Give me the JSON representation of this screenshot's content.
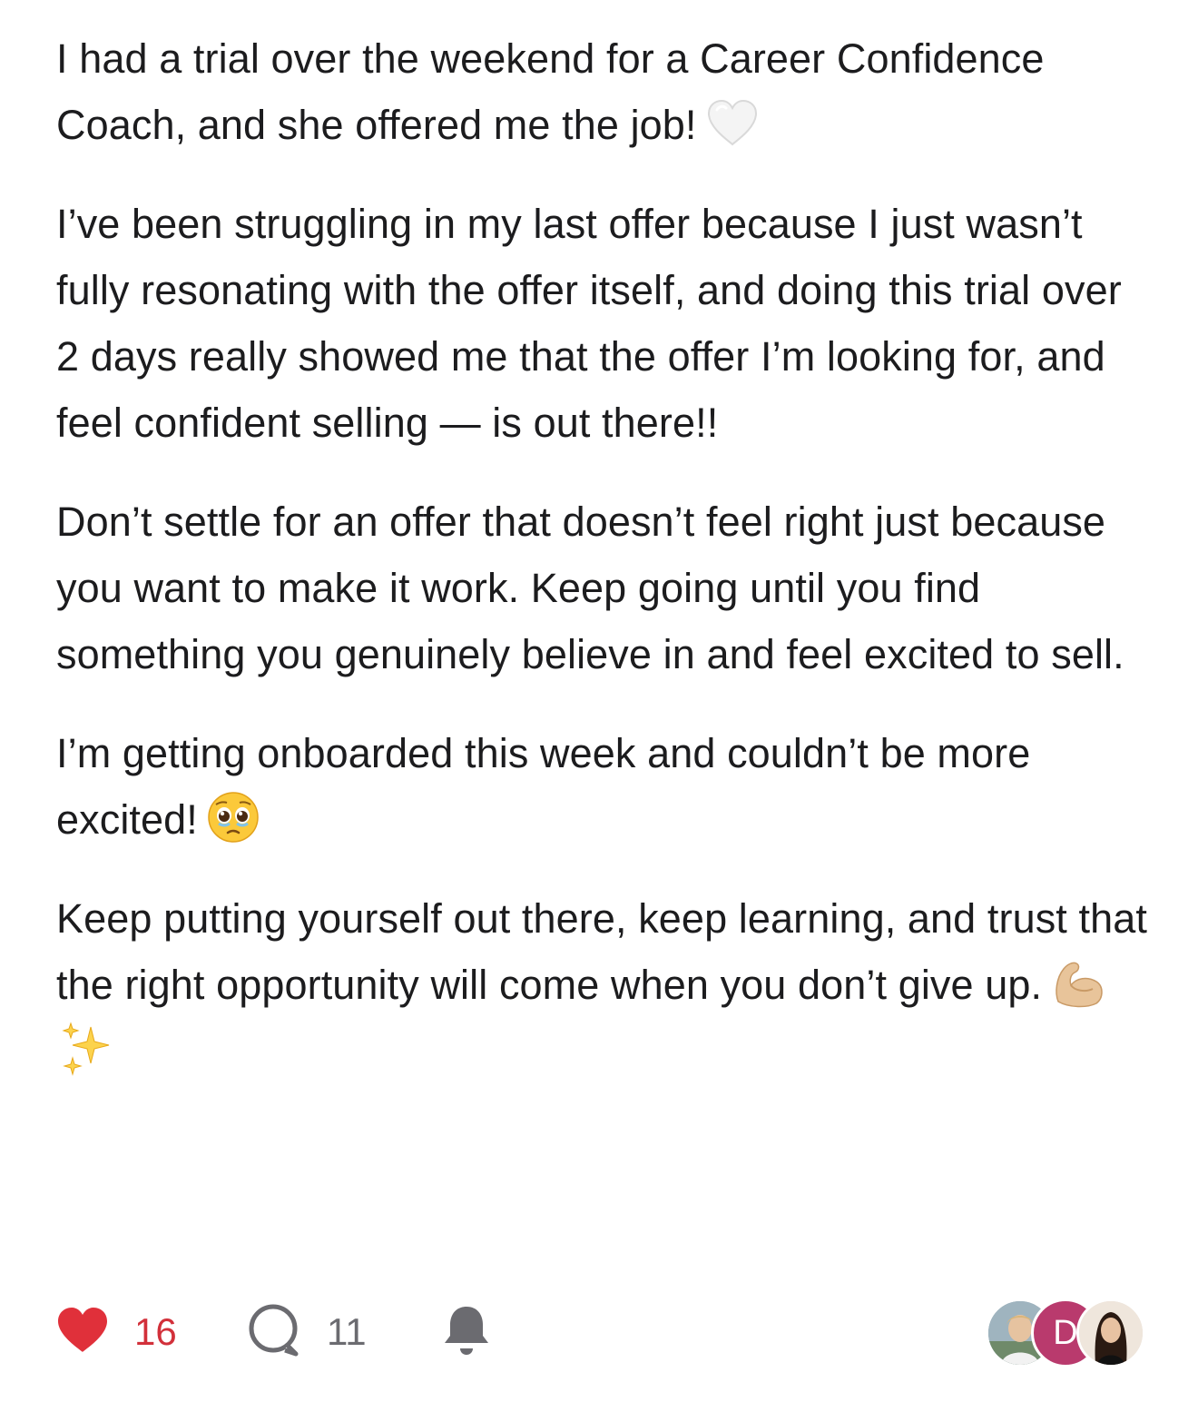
{
  "post": {
    "paragraphs": [
      {
        "text": "I had a trial over the weekend for a Career Confidence Coach, and she offered me the job!",
        "emoji": [
          "white-heart-icon"
        ]
      },
      {
        "text": "I’ve been struggling in my last offer because I just wasn’t fully resonating with the offer itself, and doing this trial over 2 days really showed me that the offer I’m looking for, and feel confident selling — is out there!!",
        "emoji": []
      },
      {
        "text": "Don’t settle for an offer that doesn’t feel right just because you want to make it work. Keep going until you find something you genuinely believe in and feel excited to sell.",
        "emoji": []
      },
      {
        "text": "I’m getting onboarded this week and couldn’t be more excited!",
        "emoji": [
          "pleading-face-icon"
        ]
      },
      {
        "text": "Keep putting yourself out there, keep learning, and trust that the right opportunity will come when you don’t give up.",
        "emoji": [
          "flexed-biceps-icon",
          "sparkles-icon"
        ]
      }
    ]
  },
  "footer": {
    "likes": "16",
    "comments": "11",
    "like_color": "#d2303a",
    "avatar_initial": "D"
  }
}
